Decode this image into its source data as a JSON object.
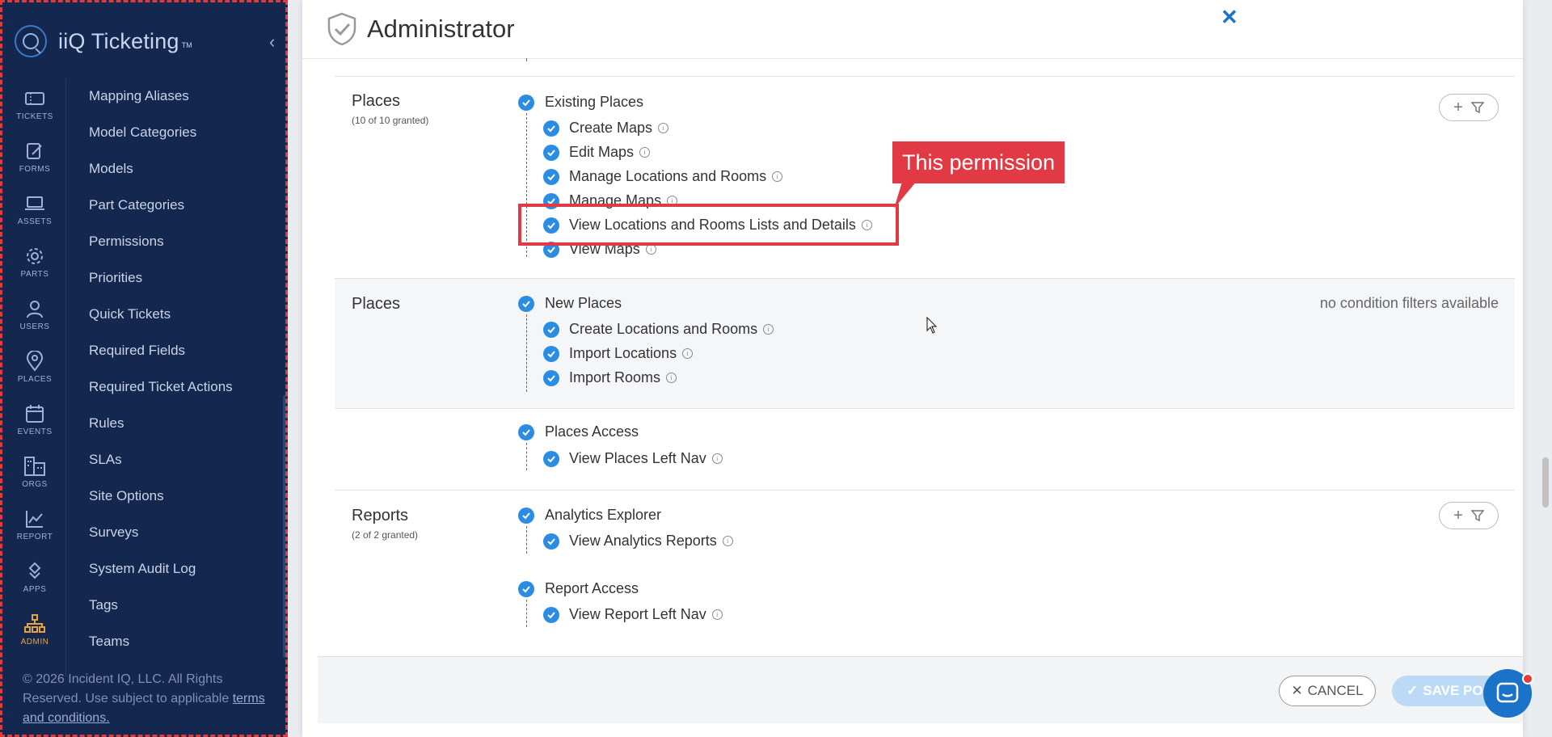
{
  "app": {
    "name": "iiQ Ticketing",
    "trademark": "TM"
  },
  "rail": [
    {
      "label": "TICKETS",
      "icon": "ticket-icon"
    },
    {
      "label": "FORMS",
      "icon": "forms-icon"
    },
    {
      "label": "ASSETS",
      "icon": "laptop-icon"
    },
    {
      "label": "PARTS",
      "icon": "gear-icon"
    },
    {
      "label": "USERS",
      "icon": "user-icon"
    },
    {
      "label": "PLACES",
      "icon": "map-pin-icon"
    },
    {
      "label": "EVENTS",
      "icon": "calendar-icon"
    },
    {
      "label": "ORGS",
      "icon": "org-grid-icon"
    },
    {
      "label": "REPORT",
      "icon": "chart-icon"
    },
    {
      "label": "APPS",
      "icon": "apps-icon"
    },
    {
      "label": "ADMIN",
      "icon": "org-chart-icon"
    }
  ],
  "menu": [
    "Mapping Aliases",
    "Model Categories",
    "Models",
    "Part Categories",
    "Permissions",
    "Priorities",
    "Quick Tickets",
    "Required Fields",
    "Required Ticket Actions",
    "Rules",
    "SLAs",
    "Site Options",
    "Surveys",
    "System Audit Log",
    "Tags",
    "Teams"
  ],
  "footer": {
    "text": "© 2026 Incident IQ, LLC. All Rights Reserved. Use subject to applicable",
    "link": "terms and conditions."
  },
  "modal": {
    "title": "Administrator",
    "cancel": "CANCEL",
    "save": "SAVE POL"
  },
  "sections": {
    "places1": {
      "title": "Places",
      "sub": "(10 of 10 granted)",
      "group": "Existing Places",
      "perms": [
        "Create Maps",
        "Edit Maps",
        "Manage Locations and Rooms",
        "Manage Maps",
        "View Locations and Rooms Lists and Details",
        "View Maps"
      ]
    },
    "places2": {
      "title": "Places",
      "group": "New Places",
      "note": "no condition filters available",
      "perms": [
        "Create Locations and Rooms",
        "Import Locations",
        "Import Rooms"
      ]
    },
    "places3": {
      "group": "Places Access",
      "perms": [
        "View Places Left Nav"
      ]
    },
    "reports": {
      "title": "Reports",
      "sub": "(2 of 2 granted)",
      "group": "Analytics Explorer",
      "perms": [
        "View Analytics Reports"
      ],
      "group2": "Report Access",
      "perms2": [
        "View Report Left Nav"
      ]
    }
  },
  "callout": {
    "text": "This permission"
  },
  "colors": {
    "nav_bg": "#14274e",
    "accent": "#2b8ce3",
    "callout": "#e23a44",
    "admin_active": "#e8a33d"
  }
}
